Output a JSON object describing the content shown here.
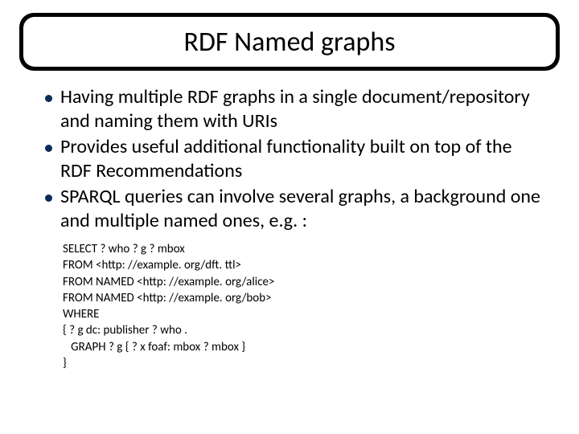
{
  "title": "RDF Named graphs",
  "bullets": [
    "Having multiple RDF graphs in a single document/repository and naming them with URIs",
    "Provides useful additional functionality built on top of the RDF Recommendations",
    "SPARQL queries can involve several graphs, a background one and multiple named ones, e.g. :"
  ],
  "code": [
    "SELECT ? who ? g ? mbox",
    "FROM <http: //example. org/dft. ttl>",
    "FROM NAMED <http: //example. org/alice>",
    "FROM NAMED <http: //example. org/bob>",
    "WHERE",
    "{ ? g dc: publisher ? who .",
    "   GRAPH ? g { ? x foaf: mbox ? mbox }",
    "}"
  ]
}
